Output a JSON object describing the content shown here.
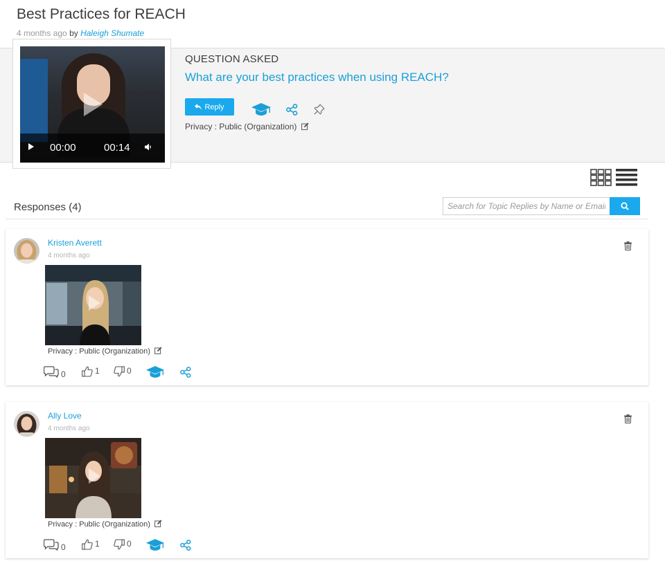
{
  "topic": {
    "title": "Best Practices for REACH",
    "time_ago": "4 months ago",
    "by_label": "by",
    "author": "Haleigh Shumate"
  },
  "question": {
    "label": "QUESTION ASKED",
    "text": "What are your best practices when using REACH?",
    "reply_label": "Reply",
    "privacy": "Privacy : Public (Organization)",
    "video": {
      "current_time": "00:00",
      "duration": "00:14"
    }
  },
  "responses": {
    "title": "Responses (4)",
    "search_placeholder": "Search for Topic Replies by Name or Email...",
    "items": [
      {
        "name": "Kristen Averett",
        "time_ago": "4 months ago",
        "privacy": "Privacy : Public (Organization)",
        "comments": "0",
        "likes": "1",
        "dislikes": "0"
      },
      {
        "name": "Ally Love",
        "time_ago": "4 months ago",
        "privacy": "Privacy : Public (Organization)",
        "comments": "0",
        "likes": "1",
        "dislikes": "0"
      }
    ]
  },
  "colors": {
    "accent": "#1aa9ec",
    "link": "#1a9fd8",
    "band": "#f4f4f4"
  },
  "icons": [
    "reply-icon",
    "graduation-cap-icon",
    "share-icon",
    "pin-icon",
    "edit-icon",
    "grid-view-icon",
    "list-view-icon",
    "search-icon",
    "trash-icon",
    "comment-icon",
    "thumbs-up-icon",
    "thumbs-down-icon",
    "play-icon",
    "volume-icon"
  ]
}
